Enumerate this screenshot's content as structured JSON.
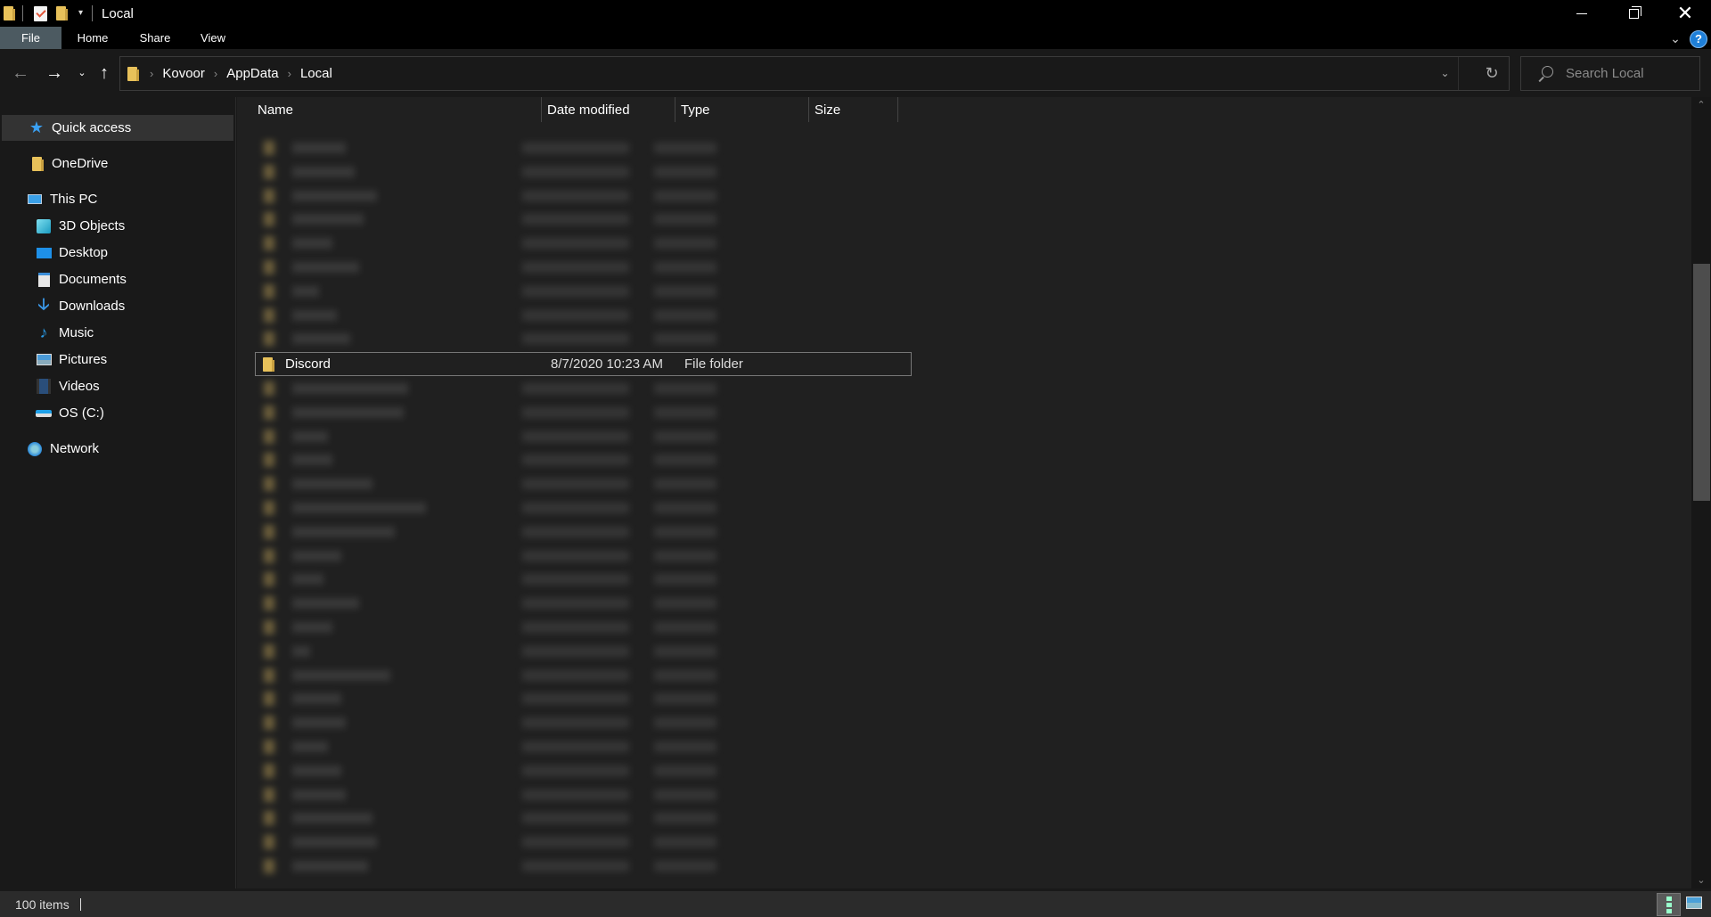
{
  "window": {
    "title": "Local",
    "controls": {
      "minimize": "minimize",
      "restore": "restore",
      "close": "close"
    }
  },
  "quick_access_toolbar": {
    "icons": [
      "folder-icon",
      "properties-icon",
      "new-folder-icon",
      "customize-dropdown-icon"
    ]
  },
  "ribbon": {
    "tabs": [
      {
        "label": "File",
        "active": true
      },
      {
        "label": "Home"
      },
      {
        "label": "Share"
      },
      {
        "label": "View"
      }
    ],
    "help_label": "?"
  },
  "navigation": {
    "back": "←",
    "forward": "→",
    "recent": "⌄",
    "up": "↑",
    "breadcrumb": [
      "Kovoor",
      "AppData",
      "Local"
    ],
    "refresh": "↻",
    "dropdown": "⌄"
  },
  "search": {
    "placeholder": "Search Local",
    "value": ""
  },
  "sidebar": {
    "items": [
      {
        "label": "Quick access",
        "icon": "star-icon",
        "active": true
      },
      {
        "label": "OneDrive",
        "icon": "folder-icon"
      },
      {
        "label": "This PC",
        "icon": "computer-icon"
      },
      {
        "label": "3D Objects",
        "icon": "cube-icon"
      },
      {
        "label": "Desktop",
        "icon": "desktop-icon"
      },
      {
        "label": "Documents",
        "icon": "document-icon"
      },
      {
        "label": "Downloads",
        "icon": "download-icon"
      },
      {
        "label": "Music",
        "icon": "music-icon"
      },
      {
        "label": "Pictures",
        "icon": "picture-icon"
      },
      {
        "label": "Videos",
        "icon": "video-icon"
      },
      {
        "label": "OS (C:)",
        "icon": "drive-icon"
      },
      {
        "label": "Network",
        "icon": "network-icon"
      }
    ]
  },
  "file_list": {
    "columns": [
      "Name",
      "Date modified",
      "Type",
      "Size"
    ],
    "sort_indicator": "^",
    "selected_row": {
      "name": "Discord",
      "date_modified": "8/7/2020 10:23 AM",
      "type": "File folder",
      "size": ""
    },
    "obscured_rows_above": 9,
    "obscured_rows_below": 21
  },
  "status_bar": {
    "item_count": "100 items"
  },
  "colors": {
    "accent": "#1e7fd8",
    "folder": "#e8c15a",
    "file_tab": "#4c5a61"
  }
}
